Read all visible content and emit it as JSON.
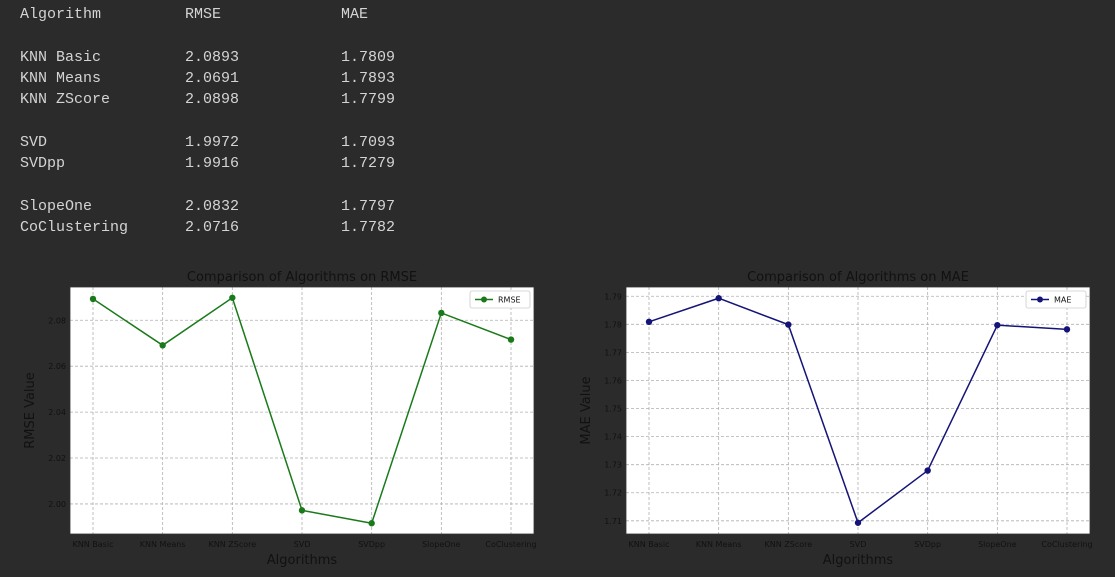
{
  "results_table": {
    "header": [
      "Algorithm",
      "RMSE",
      "MAE"
    ],
    "groups": [
      [
        {
          "algorithm": "KNN Basic",
          "rmse": "2.0893",
          "mae": "1.7809"
        },
        {
          "algorithm": "KNN Means",
          "rmse": "2.0691",
          "mae": "1.7893"
        },
        {
          "algorithm": "KNN ZScore",
          "rmse": "2.0898",
          "mae": "1.7799"
        }
      ],
      [
        {
          "algorithm": "SVD",
          "rmse": "1.9972",
          "mae": "1.7093"
        },
        {
          "algorithm": "SVDpp",
          "rmse": "1.9916",
          "mae": "1.7279"
        }
      ],
      [
        {
          "algorithm": "SlopeOne",
          "rmse": "2.0832",
          "mae": "1.7797"
        },
        {
          "algorithm": "CoClustering",
          "rmse": "2.0716",
          "mae": "1.7782"
        }
      ]
    ]
  },
  "chart_data": [
    {
      "type": "line",
      "title": "Comparison of Algorithms on RMSE",
      "xlabel": "Algorithms",
      "ylabel": "RMSE Value",
      "categories": [
        "KNN Basic",
        "KNN Means",
        "KNN ZScore",
        "SVD",
        "SVDpp",
        "SlopeOne",
        "CoClustering"
      ],
      "series": [
        {
          "name": "RMSE",
          "values": [
            2.0893,
            2.0691,
            2.0898,
            1.9972,
            1.9916,
            2.0832,
            2.0716
          ],
          "color": "#1a7a1a"
        }
      ],
      "ylim": [
        1.9869,
        2.0945
      ],
      "yticks": [
        2.0,
        2.02,
        2.04,
        2.06,
        2.08
      ],
      "ytick_labels": [
        "2.00",
        "2.02",
        "2.04",
        "2.06",
        "2.08"
      ],
      "grid": true,
      "legend": "top-right"
    },
    {
      "type": "line",
      "title": "Comparison of Algorithms on MAE",
      "xlabel": "Algorithms",
      "ylabel": "MAE Value",
      "categories": [
        "KNN Basic",
        "KNN Means",
        "KNN ZScore",
        "SVD",
        "SVDpp",
        "SlopeOne",
        "CoClustering"
      ],
      "series": [
        {
          "name": "MAE",
          "values": [
            1.7809,
            1.7893,
            1.7799,
            1.7093,
            1.7279,
            1.7797,
            1.7782
          ],
          "color": "#141478"
        }
      ],
      "ylim": [
        1.7053,
        1.7933
      ],
      "yticks": [
        1.71,
        1.72,
        1.73,
        1.74,
        1.75,
        1.76,
        1.77,
        1.78,
        1.79
      ],
      "ytick_labels": [
        "1.71",
        "1.72",
        "1.73",
        "1.74",
        "1.75",
        "1.76",
        "1.77",
        "1.78",
        "1.79"
      ],
      "grid": true,
      "legend": "top-right"
    }
  ]
}
